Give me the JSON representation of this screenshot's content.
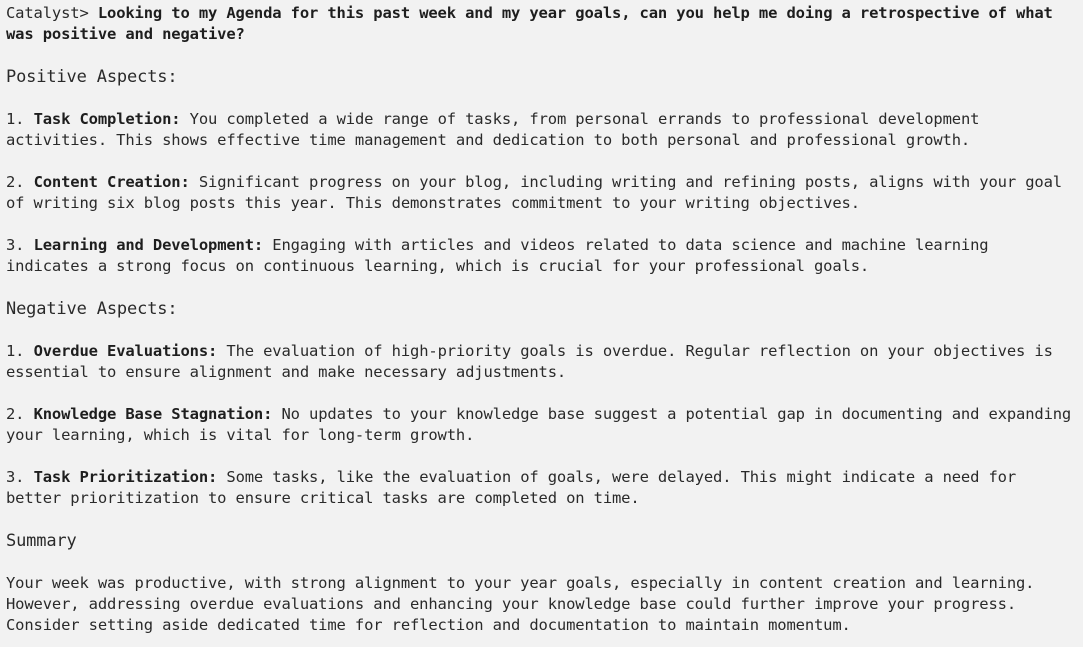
{
  "prompt": {
    "label": "Catalyst>",
    "question": "Looking to my Agenda for this past week and my year goals, can you help me doing a retrospective of what was positive and negative?"
  },
  "positive": {
    "heading": "Positive Aspects:",
    "items": [
      {
        "num": "1.",
        "title": "Task Completion:",
        "text": "You completed a wide range of tasks, from personal errands to professional development activities. This shows effective time management and dedication to both personal and professional growth."
      },
      {
        "num": "2.",
        "title": "Content Creation:",
        "text": "Significant progress on your blog, including writing and refining posts, aligns with your goal of writing six blog posts this year. This demonstrates commitment to your writing objectives."
      },
      {
        "num": "3.",
        "title": "Learning and Development:",
        "text": "Engaging with articles and videos related to data science and machine learning indicates a strong focus on continuous learning, which is crucial for your professional goals."
      }
    ]
  },
  "negative": {
    "heading": "Negative Aspects:",
    "items": [
      {
        "num": "1.",
        "title": "Overdue Evaluations:",
        "text": "The evaluation of high-priority goals is overdue. Regular reflection on your objectives is essential to ensure alignment and make necessary adjustments."
      },
      {
        "num": "2.",
        "title": "Knowledge Base Stagnation:",
        "text": "No updates to your knowledge base suggest a potential gap in documenting and expanding your learning, which is vital for long-term growth."
      },
      {
        "num": "3.",
        "title": "Task Prioritization:",
        "text": "Some tasks, like the evaluation of goals, were delayed. This might indicate a need for better prioritization to ensure critical tasks are completed on time."
      }
    ]
  },
  "summary": {
    "heading": "Summary",
    "text": "Your week was productive, with strong alignment to your year goals, especially in content creation and learning. However, addressing overdue evaluations and enhancing your knowledge base could further improve your progress. Consider setting aside dedicated time for reflection and documentation to maintain momentum."
  }
}
